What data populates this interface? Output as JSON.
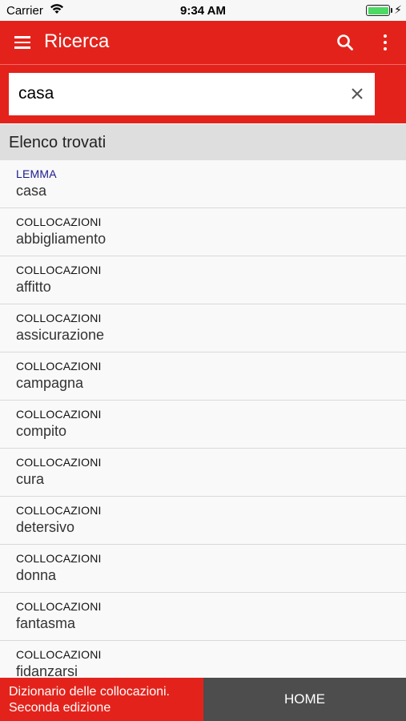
{
  "status_bar": {
    "carrier": "Carrier",
    "time": "9:34 AM"
  },
  "app_bar": {
    "title": "Ricerca",
    "icons": [
      "menu-icon",
      "search-icon",
      "more-vert-icon"
    ]
  },
  "search": {
    "value": "casa",
    "clear_icon": "close-icon"
  },
  "list_header": "Elenco trovati",
  "results": [
    {
      "category": "LEMMA",
      "term": "casa"
    },
    {
      "category": "COLLOCAZIONI",
      "term": "abbigliamento"
    },
    {
      "category": "COLLOCAZIONI",
      "term": "affitto"
    },
    {
      "category": "COLLOCAZIONI",
      "term": "assicurazione"
    },
    {
      "category": "COLLOCAZIONI",
      "term": "campagna"
    },
    {
      "category": "COLLOCAZIONI",
      "term": "compito"
    },
    {
      "category": "COLLOCAZIONI",
      "term": "cura"
    },
    {
      "category": "COLLOCAZIONI",
      "term": "detersivo"
    },
    {
      "category": "COLLOCAZIONI",
      "term": "donna"
    },
    {
      "category": "COLLOCAZIONI",
      "term": "fantasma"
    },
    {
      "category": "COLLOCAZIONI",
      "term": "fidanzarsi"
    }
  ],
  "bottom_bar": {
    "dictionary_line1": "Dizionario delle collocazioni.",
    "dictionary_line2": "Seconda edizione",
    "home_label": "HOME"
  },
  "colors": {
    "accent": "#e3231b",
    "lemma": "#1b1b8f",
    "home_bg": "#4d4d4d",
    "battery": "#4cd964"
  }
}
